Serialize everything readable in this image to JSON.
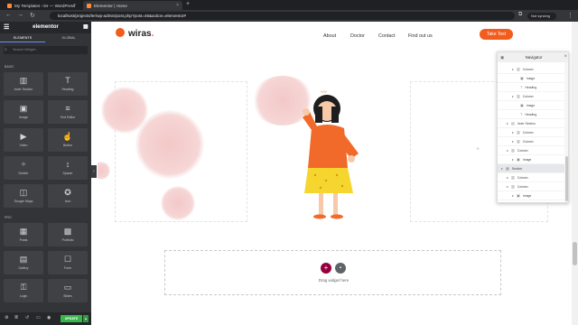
{
  "browser": {
    "tabs": [
      {
        "title": "My Templates ‹ ler — WordPress"
      },
      {
        "title": "Elementor | Home"
      }
    ],
    "new_tab_symbol": "+",
    "url": "localhost/projects/ler/wp-admin/post.php?post=46&action=elementor#",
    "sync_label": "Not syncing"
  },
  "panel": {
    "title": "elementor",
    "tabs": [
      "ELEMENTS",
      "GLOBAL"
    ],
    "search_placeholder": "Search Widget...",
    "sections": [
      {
        "label": "BASIC"
      },
      {
        "label": "PRO"
      }
    ],
    "widgets_basic": [
      {
        "label": "Inner Section",
        "icon": "columns-icon",
        "glyph": "▥"
      },
      {
        "label": "Heading",
        "icon": "heading-icon",
        "glyph": "T"
      },
      {
        "label": "Image",
        "icon": "image-icon",
        "glyph": "▣"
      },
      {
        "label": "Text Editor",
        "icon": "text-editor-icon",
        "glyph": "≡"
      },
      {
        "label": "Video",
        "icon": "video-icon",
        "glyph": "▶"
      },
      {
        "label": "Button",
        "icon": "button-icon",
        "glyph": "☝"
      },
      {
        "label": "Divider",
        "icon": "divider-icon",
        "glyph": "÷"
      },
      {
        "label": "Spacer",
        "icon": "spacer-icon",
        "glyph": "↕"
      },
      {
        "label": "Google Maps",
        "icon": "map-icon",
        "glyph": "◫"
      },
      {
        "label": "Icon",
        "icon": "star-icon",
        "glyph": "✪"
      }
    ],
    "widgets_pro": [
      {
        "label": "Posts",
        "icon": "posts-icon",
        "glyph": "▦"
      },
      {
        "label": "Portfolio",
        "icon": "portfolio-icon",
        "glyph": "▩"
      },
      {
        "label": "Gallery",
        "icon": "gallery-icon",
        "glyph": "▤"
      },
      {
        "label": "Form",
        "icon": "form-icon",
        "glyph": "☐"
      },
      {
        "label": "Login",
        "icon": "login-icon",
        "glyph": "⚿"
      },
      {
        "label": "Slides",
        "icon": "slides-icon",
        "glyph": "▭"
      }
    ],
    "update_label": "UPDATE"
  },
  "site": {
    "logo_text": "wiras",
    "nav": [
      "About",
      "Doctor",
      "Contact",
      "Find out us"
    ],
    "cta_label": "Take Test",
    "drop_text": "Drag widget here"
  },
  "navigator": {
    "title": "Navigator",
    "items": [
      {
        "label": "Column",
        "icon": "column-icon",
        "level": 2
      },
      {
        "label": "Image",
        "icon": "image-icon",
        "level": 3
      },
      {
        "label": "Heading",
        "icon": "heading-icon",
        "level": 3
      },
      {
        "label": "Column",
        "icon": "column-icon",
        "level": 2
      },
      {
        "label": "Image",
        "icon": "image-icon",
        "level": 3
      },
      {
        "label": "Heading",
        "icon": "heading-icon",
        "level": 3
      },
      {
        "label": "Inner Section",
        "icon": "columns-icon",
        "level": 1
      },
      {
        "label": "Column",
        "icon": "column-icon",
        "level": 2
      },
      {
        "label": "Column",
        "icon": "column-icon",
        "level": 2
      },
      {
        "label": "Column",
        "icon": "column-icon",
        "level": 1
      },
      {
        "label": "Image",
        "icon": "image-icon",
        "level": 2
      },
      {
        "label": "Section",
        "icon": "section-icon",
        "level": 0,
        "selected": true
      },
      {
        "label": "Column",
        "icon": "column-icon",
        "level": 1
      },
      {
        "label": "Column",
        "icon": "column-icon",
        "level": 1
      },
      {
        "label": "Image",
        "icon": "image-icon",
        "level": 2
      }
    ]
  },
  "colors": {
    "brand_orange": "#f25c1d",
    "panel_bg": "#333437",
    "update_green": "#39b54a",
    "add_button": "#93003c"
  }
}
